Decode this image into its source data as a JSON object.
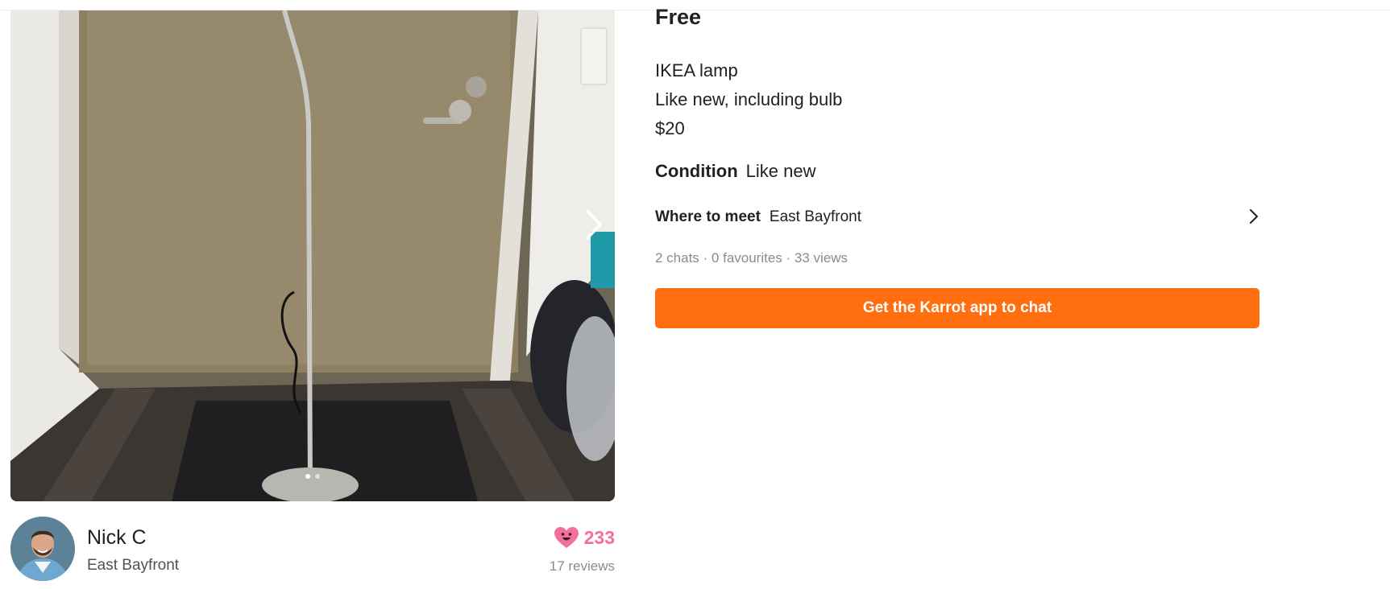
{
  "listing": {
    "price": "Free",
    "description_lines": [
      "IKEA lamp",
      "Like new, including bulb",
      "$20"
    ],
    "condition_label": "Condition",
    "condition_value": "Like new",
    "meet_label": "Where to meet",
    "meet_value": "East Bayfront",
    "stats": "2 chats · 0 favourites · 33 views",
    "cta_label": "Get the Karrot app to chat"
  },
  "gallery": {
    "next_icon": "chevron-right-icon",
    "image_count": 2,
    "current_image": 1
  },
  "seller": {
    "name": "Nick C",
    "location": "East Bayfront",
    "manner_temp": "233",
    "reviews": "17 reviews"
  },
  "colors": {
    "accent": "#ff6f0f",
    "manner": "#f2709c",
    "muted": "#868b94"
  }
}
